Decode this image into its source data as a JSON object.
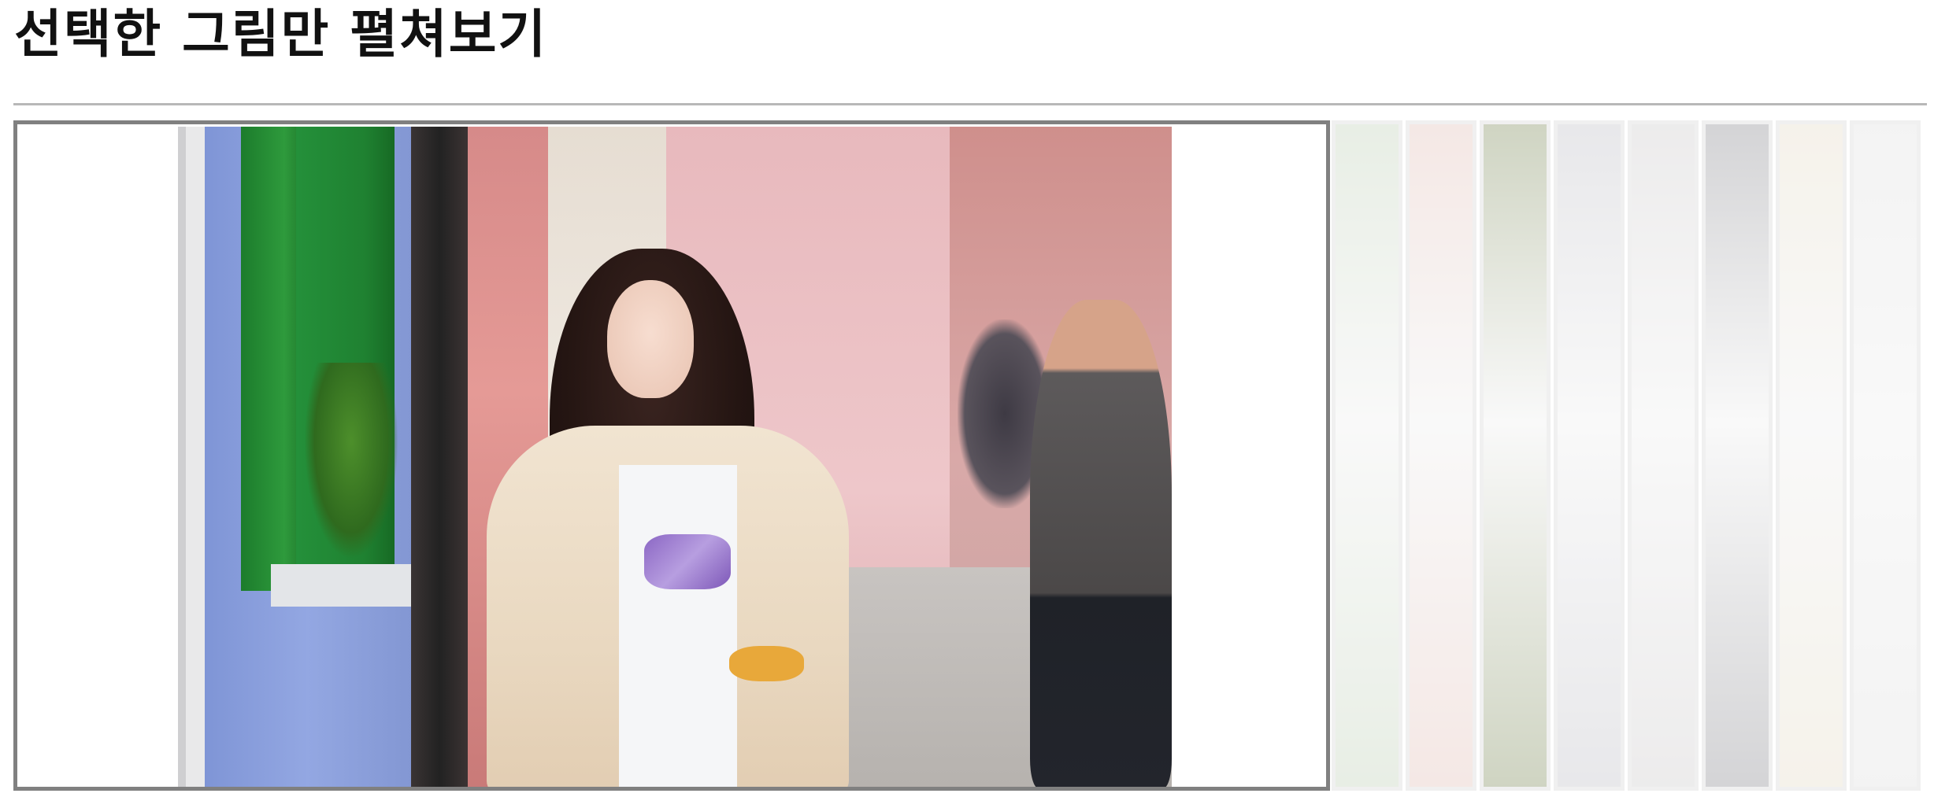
{
  "page": {
    "title": "선택한 그림만 펼쳐보기"
  },
  "gallery": {
    "selected_index": 0,
    "thumbnails": [
      {
        "name": "thumbnail-1",
        "tone": "#c9d8c2"
      },
      {
        "name": "thumbnail-2",
        "tone": "#e7c9c2"
      },
      {
        "name": "thumbnail-3",
        "tone": "#8f9b70"
      },
      {
        "name": "thumbnail-4",
        "tone": "#c9c9cf"
      },
      {
        "name": "thumbnail-5",
        "tone": "#d4d2d3"
      },
      {
        "name": "thumbnail-6",
        "tone": "#9a9a9f"
      },
      {
        "name": "thumbnail-7",
        "tone": "#e9e1cf"
      },
      {
        "name": "thumbnail-8",
        "tone": "#e4e4e4"
      }
    ]
  },
  "colors": {
    "selected_border": "#808080",
    "thumbnail_border": "#dcdcdc",
    "divider": "#b8b8b8"
  }
}
